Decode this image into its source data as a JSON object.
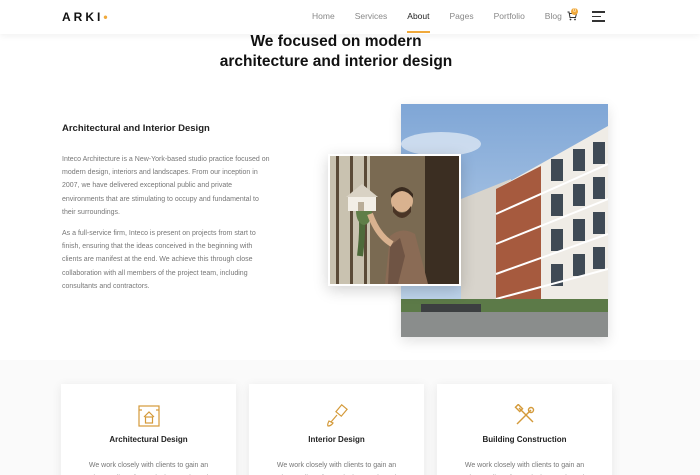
{
  "header": {
    "logo": "ARKI",
    "logo_dot": "•",
    "nav": [
      "Home",
      "Services",
      "About",
      "Pages",
      "Portfolio",
      "Blog"
    ],
    "active_nav": "About",
    "cart_count": "0",
    "accent_color": "#f0a93b"
  },
  "hero": {
    "title_line1": "We focused on modern",
    "title_line2": "architecture and interior design"
  },
  "about": {
    "title": "Architectural and Interior Design",
    "paragraph1": "Inteco Architecture is a New-York-based studio practice focused on modern design, interiors and landscapes. From our inception in 2007, we have delivered exceptional public and private environments that are stimulating to occupy and fundamental to their surroundings.",
    "paragraph2": "As a full-service firm, Inteco is present on projects from start to finish, ensuring that the ideas conceived in the beginning with clients are manifest at the end. We achieve this through close collaboration with all members of the project team, including consultants and contractors."
  },
  "cards": [
    {
      "icon": "blueprint-house-icon",
      "title": "Architectural Design",
      "text": "We work closely with clients to gain an understanding of your designs and needs."
    },
    {
      "icon": "paint-brush-icon",
      "title": "Interior Design",
      "text": "We work closely with clients to gain an understanding of your designs and needs."
    },
    {
      "icon": "hammer-wrench-icon",
      "title": "Building Construction",
      "text": "We work closely with clients to gain an understanding of your designs and needs."
    }
  ]
}
